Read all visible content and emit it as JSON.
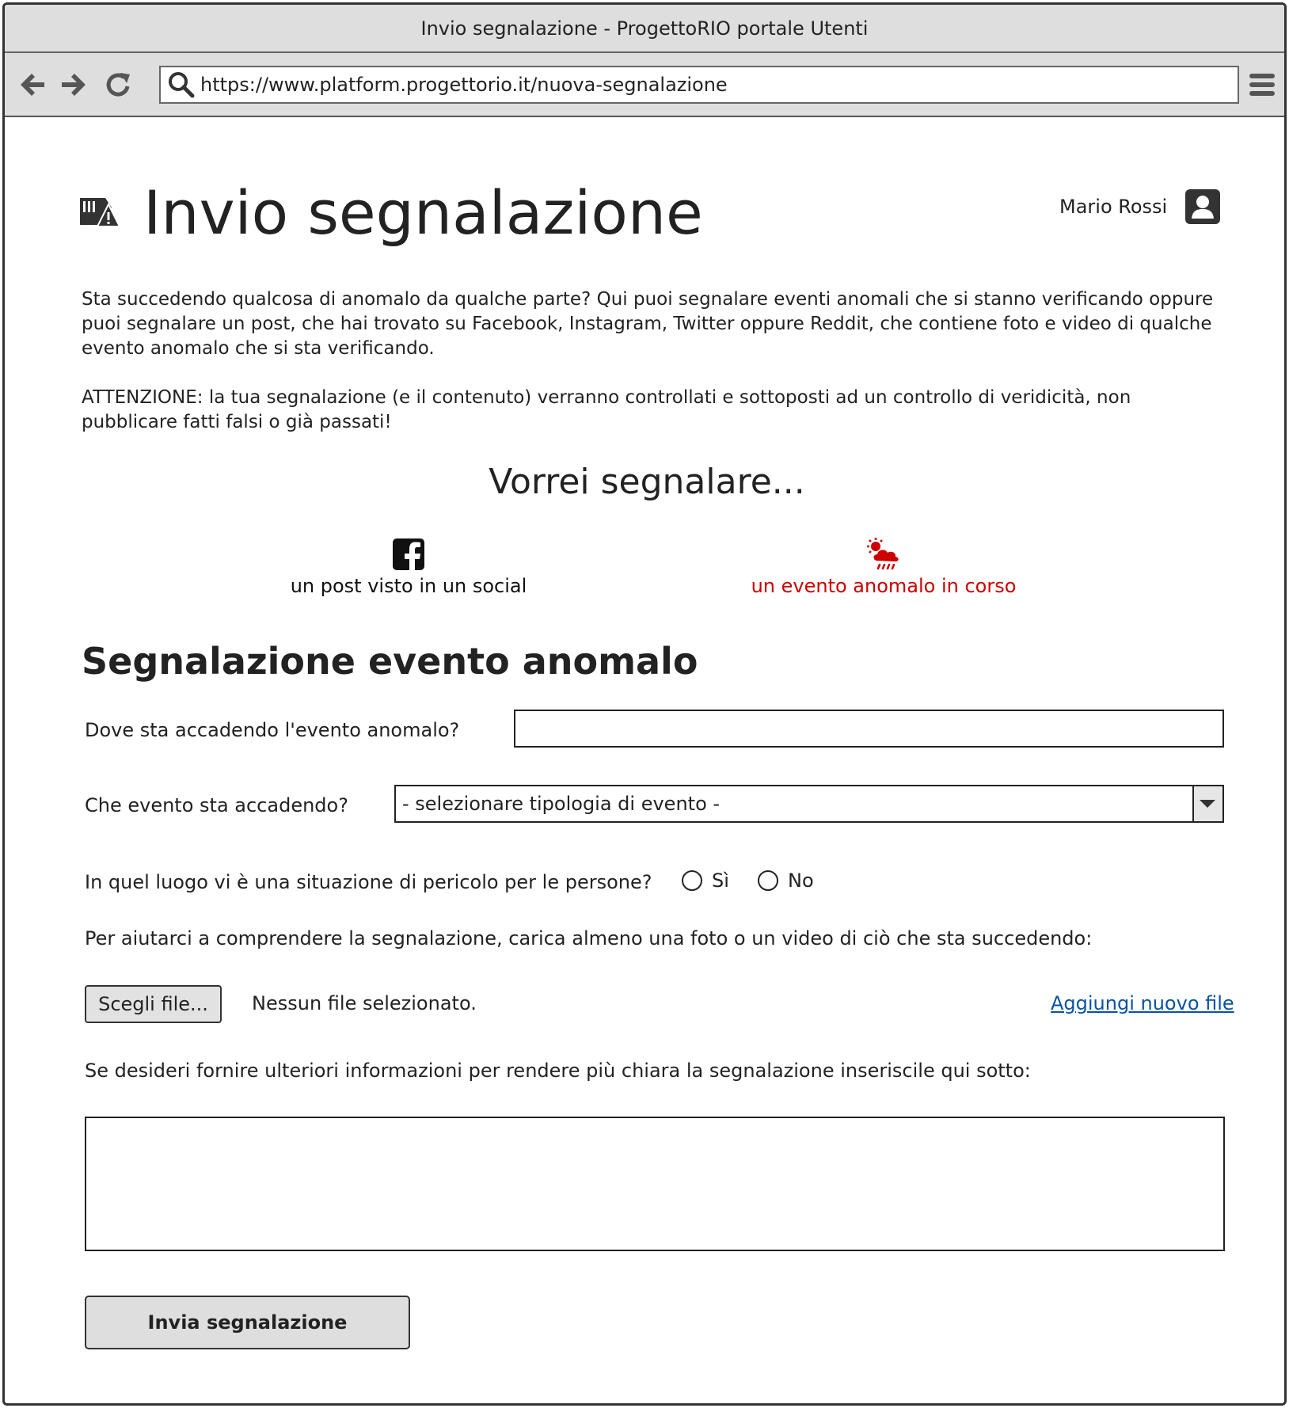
{
  "window": {
    "title": "Invio segnalazione - ProgettoRIO portale Utenti"
  },
  "browser": {
    "url": "https://www.platform.progettorio.it/nuova-segnalazione",
    "icons": [
      "back-arrow-icon",
      "forward-arrow-icon",
      "reload-icon",
      "search-icon",
      "hamburger-menu-icon"
    ]
  },
  "header": {
    "title": "Invio segnalazione",
    "title_icon": "report-warning-icon",
    "user_name": "Mario Rossi",
    "user_icon": "user-avatar-icon"
  },
  "intro": {
    "paragraph1": "Sta succedendo qualcosa di anomalo da qualche parte? Qui puoi segnalare eventi anomali che si stanno verificando oppure puoi segnalare un post, che hai trovato su Facebook, Instagram, Twitter oppure Reddit, che contiene foto e video di qualche evento anomalo che si sta verificando.",
    "paragraph2": "ATTENZIONE: la tua segnalazione (e il contenuto) verranno controllati e sottoposti ad un controllo di veridicità, non pubblicare fatti falsi o già passati!"
  },
  "choice": {
    "title": "Vorrei segnalare...",
    "options": [
      {
        "label": "un post visto in un social",
        "icon": "facebook-icon",
        "selected": false
      },
      {
        "label": "un evento anomalo in corso",
        "icon": "weather-storm-icon",
        "selected": true
      }
    ],
    "selected_color": "#cc0000"
  },
  "form": {
    "section_title": "Segnalazione evento anomalo",
    "where_label": "Dove sta accadendo l'evento anomalo?",
    "where_value": "",
    "event_label": "Che evento sta accadendo?",
    "event_selected": "- selezionare tipologia di evento -",
    "danger_label": "In quel luogo vi è una situazione di pericolo per le persone?",
    "danger_options": [
      "Sì",
      "No"
    ],
    "upload_label": "Per aiutarci a comprendere la segnalazione, carica almeno una foto o un video di ciò che sta succedendo:",
    "choose_file_label": "Scegli file...",
    "file_status": "Nessun file selezionato.",
    "add_file_link": "Aggiungi nuovo file",
    "link_color": "#0a52a4",
    "more_info_label": "Se desideri fornire ulteriori informazioni per rendere più chiara la segnalazione inseriscile qui sotto:",
    "more_info_value": "",
    "submit_label": "Invia segnalazione"
  }
}
